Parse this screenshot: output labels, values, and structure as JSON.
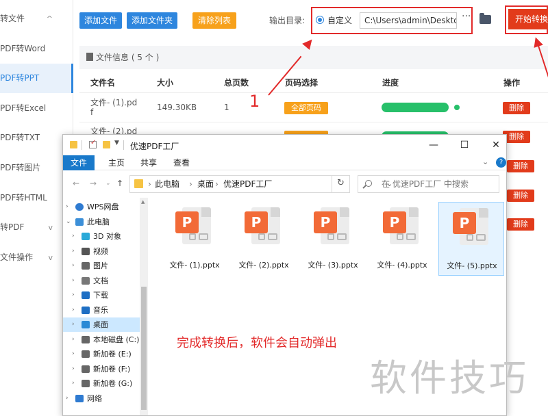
{
  "sidebar": {
    "items": [
      {
        "label": "转文件",
        "chevron": "^"
      },
      {
        "label": "PDF转Word"
      },
      {
        "label": "PDF转PPT"
      },
      {
        "label": "PDF转Excel"
      },
      {
        "label": "PDF转TXT"
      },
      {
        "label": "PDF转图片"
      },
      {
        "label": "PDF转HTML"
      },
      {
        "label": "转PDF",
        "chevron": "v"
      },
      {
        "label": "文件操作",
        "chevron": "v"
      }
    ]
  },
  "toolbar": {
    "add_file": "添加文件",
    "add_folder": "添加文件夹",
    "clear_list": "清除列表",
    "output_dir_label": "输出目录:",
    "custom_option": "自定义",
    "output_path": "C:\\Users\\admin\\Desktop",
    "more": "···",
    "start": "开始转换"
  },
  "file_info": {
    "title": "文件信息 ( 5 个 )",
    "columns": [
      "文件名",
      "大小",
      "总页数",
      "页码选择",
      "进度",
      "操作"
    ],
    "rows": [
      {
        "name_line1": "文件- (1).pd",
        "name_line2": "f",
        "size": "149.30KB",
        "pages": "1",
        "page_select": "全部页码",
        "action": "删除"
      },
      {
        "name_line1": "文件- (2).pd",
        "name_line2": "",
        "size": "",
        "pages": "",
        "page_select": "",
        "action": "删除"
      },
      {
        "action": "删除"
      },
      {
        "action": "删除"
      },
      {
        "action": "删除"
      }
    ]
  },
  "annotations": {
    "step_number": "1",
    "caption": "完成转换后，软件会自动弹出",
    "watermark": "软件技巧"
  },
  "explorer": {
    "title": "优速PDF工厂",
    "window_buttons": {
      "minimize": "—",
      "maximize": "☐",
      "close": "✕"
    },
    "ribbon_tabs": [
      "文件",
      "主页",
      "共享",
      "查看"
    ],
    "ribbon_collapse": "⌄",
    "help": "?",
    "address": [
      "此电脑",
      "桌面",
      "优速PDF工厂"
    ],
    "address_dropdown": "⌄",
    "refresh": "↻",
    "search_placeholder": "在 优速PDF工厂 中搜索",
    "nav_items": [
      {
        "label": "WPS网盘",
        "icon": "cloud-icon",
        "level": 0
      },
      {
        "label": "此电脑",
        "icon": "computer-icon",
        "level": 0,
        "expanded": true
      },
      {
        "label": "3D 对象",
        "icon": "cube-icon",
        "level": 1
      },
      {
        "label": "视频",
        "icon": "video-icon",
        "level": 1
      },
      {
        "label": "图片",
        "icon": "picture-icon",
        "level": 1
      },
      {
        "label": "文档",
        "icon": "document-icon",
        "level": 1
      },
      {
        "label": "下载",
        "icon": "download-icon",
        "level": 1
      },
      {
        "label": "音乐",
        "icon": "music-icon",
        "level": 1
      },
      {
        "label": "桌面",
        "icon": "desktop-icon",
        "level": 1,
        "selected": true
      },
      {
        "label": "本地磁盘 (C:)",
        "icon": "disk-icon",
        "level": 1
      },
      {
        "label": "新加卷 (E:)",
        "icon": "disk-icon",
        "level": 1
      },
      {
        "label": "新加卷 (F:)",
        "icon": "disk-icon",
        "level": 1
      },
      {
        "label": "新加卷 (G:)",
        "icon": "disk-icon",
        "level": 1
      },
      {
        "label": "网络",
        "icon": "network-icon",
        "level": 0
      }
    ],
    "files": [
      {
        "name": "文件- (1).pptx",
        "badge": "P"
      },
      {
        "name": "文件- (2).pptx",
        "badge": "P"
      },
      {
        "name": "文件- (3).pptx",
        "badge": "P"
      },
      {
        "name": "文件- (4).pptx",
        "badge": "P"
      },
      {
        "name": "文件- (5).pptx",
        "badge": "P",
        "selected": true
      }
    ]
  },
  "colors": {
    "primary_blue": "#2e86de",
    "orange": "#f7a11b",
    "start_red": "#e23b1b",
    "annotation_red": "#e22a2a",
    "progress_green": "#27c06a",
    "ppt_orange": "#f26a37"
  }
}
